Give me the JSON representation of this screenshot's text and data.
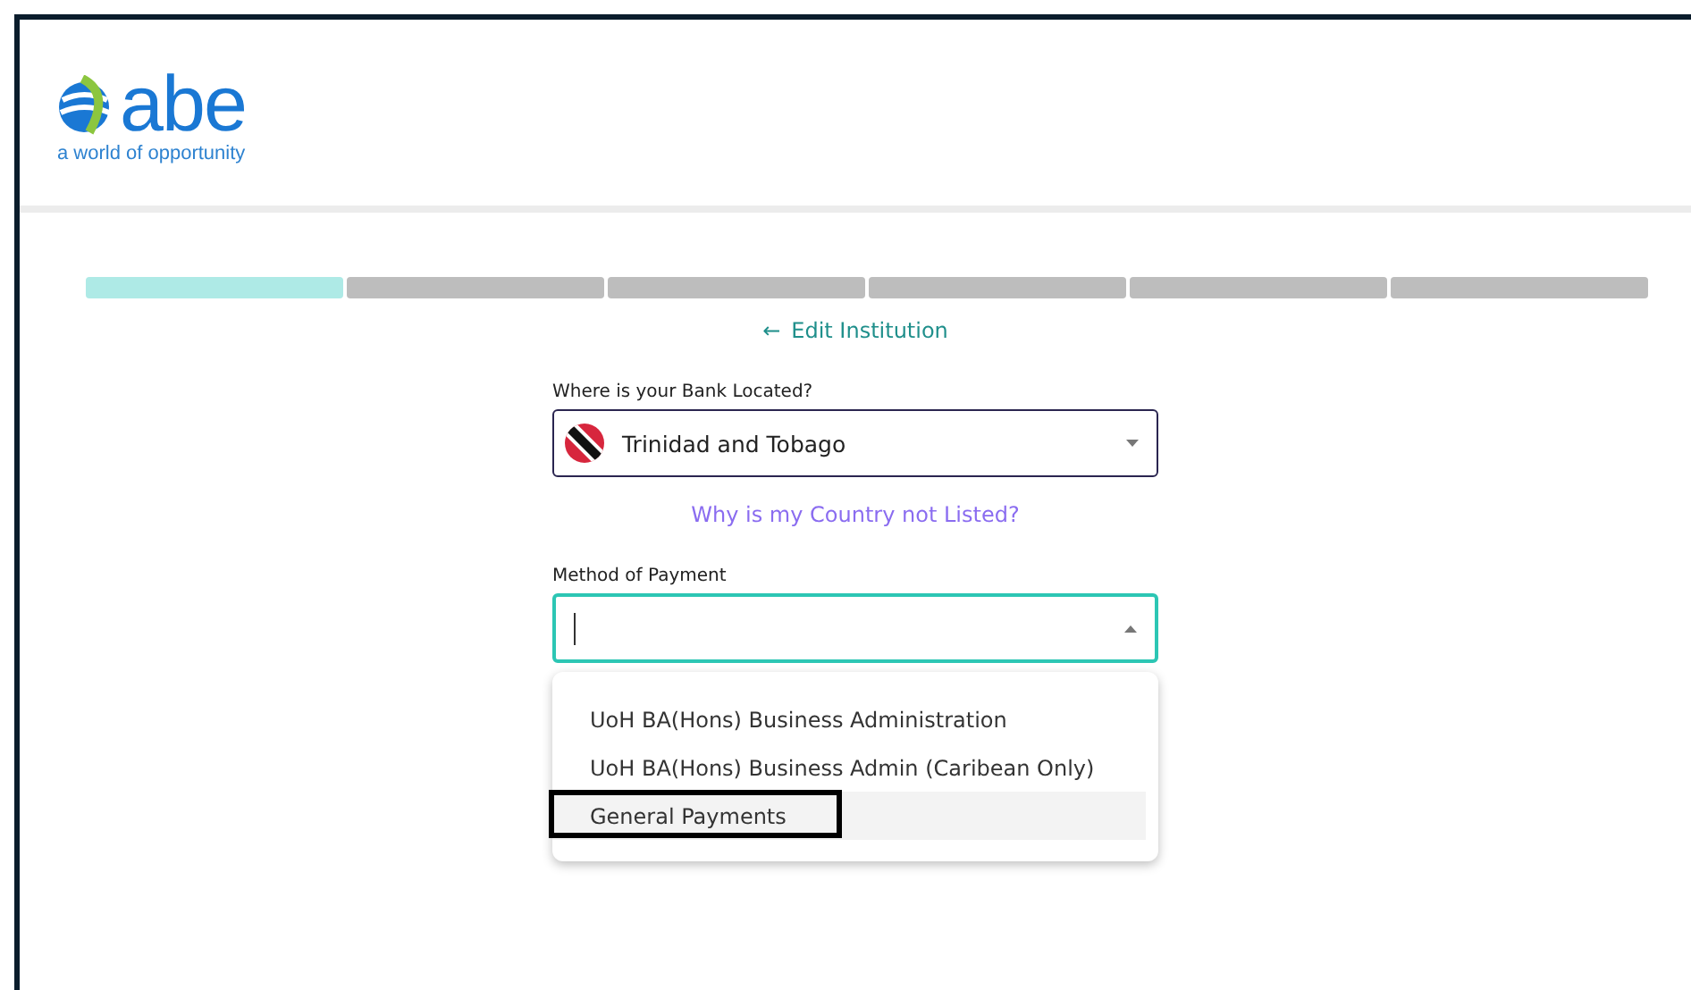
{
  "logo": {
    "wordmark": "abe",
    "tagline": "a world of opportunity"
  },
  "progress": {
    "steps": [
      {
        "done": true
      },
      {
        "done": false
      },
      {
        "done": false
      },
      {
        "done": false
      },
      {
        "done": false
      },
      {
        "done": false
      }
    ]
  },
  "back_link": {
    "arrow": "←",
    "label": "Edit Institution"
  },
  "bank_location": {
    "label": "Where is your Bank Located?",
    "value": "Trinidad and Tobago"
  },
  "help_link": "Why is my Country not Listed?",
  "payment_method": {
    "label": "Method of Payment",
    "focused": true,
    "expanded": true,
    "options": [
      {
        "label": "UoH BA(Hons) Business Administration",
        "selected": false,
        "annotated": false
      },
      {
        "label": "UoH BA(Hons) Business Admin (Caribean Only)",
        "selected": false,
        "annotated": false
      },
      {
        "label": "General Payments",
        "selected": true,
        "annotated": true
      }
    ]
  }
}
